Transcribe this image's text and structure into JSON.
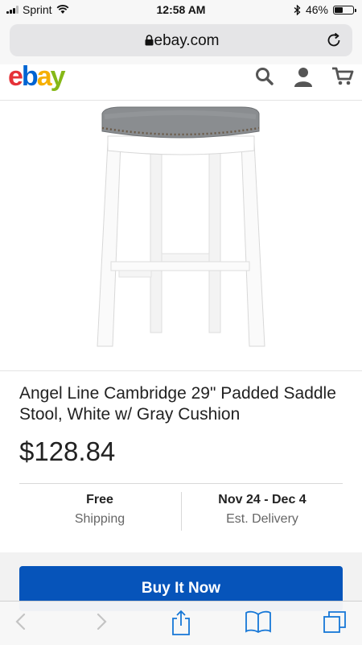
{
  "status_bar": {
    "carrier": "Sprint",
    "time": "12:58 AM",
    "battery": "46%",
    "battery_level": 0.46
  },
  "browser": {
    "url": "ebay.com"
  },
  "header": {
    "logo_letters": [
      "e",
      "b",
      "a",
      "y"
    ],
    "logo_colors": [
      "#e53238",
      "#0064d2",
      "#f5af02",
      "#86b817"
    ]
  },
  "product": {
    "title": "Angel Line Cambridge 29\" Padded Saddle Stool, White w/ Gray Cushion",
    "price": "$128.84",
    "shipping_main": "Free",
    "shipping_sub": "Shipping",
    "delivery_main": "Nov 24 - Dec 4",
    "delivery_sub": "Est. Delivery"
  },
  "actions": {
    "buy_label": "Buy It Now"
  },
  "colors": {
    "buy_button": "#0654ba"
  }
}
